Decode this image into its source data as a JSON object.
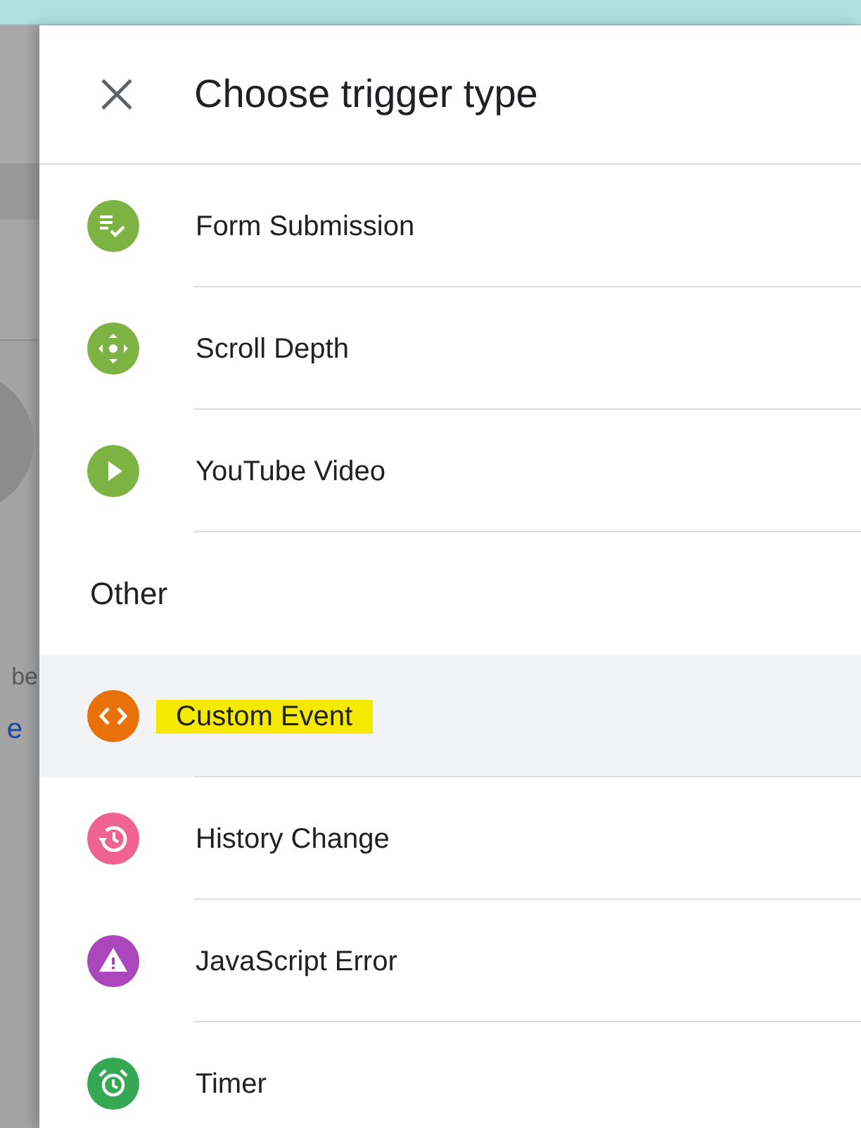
{
  "background": {
    "text": "be",
    "link": "e"
  },
  "panel": {
    "title": "Choose trigger type",
    "sections": [
      {
        "items": [
          {
            "label": "Form Submission",
            "kind": "form",
            "color": "#7cb342",
            "selected": false,
            "highlighted": false
          },
          {
            "label": "Scroll Depth",
            "kind": "scroll",
            "color": "#7cb342",
            "selected": false,
            "highlighted": false
          },
          {
            "label": "YouTube Video",
            "kind": "play",
            "color": "#7cb342",
            "selected": false,
            "highlighted": false
          }
        ]
      },
      {
        "heading": "Other",
        "items": [
          {
            "label": "Custom Event",
            "kind": "code",
            "color": "#e8710a",
            "selected": true,
            "highlighted": true
          },
          {
            "label": "History Change",
            "kind": "history",
            "color": "#f06292",
            "selected": false,
            "highlighted": false
          },
          {
            "label": "JavaScript Error",
            "kind": "warning",
            "color": "#ab47bc",
            "selected": false,
            "highlighted": false
          },
          {
            "label": "Timer",
            "kind": "timer",
            "color": "#34a853",
            "selected": false,
            "highlighted": false
          }
        ]
      }
    ]
  }
}
